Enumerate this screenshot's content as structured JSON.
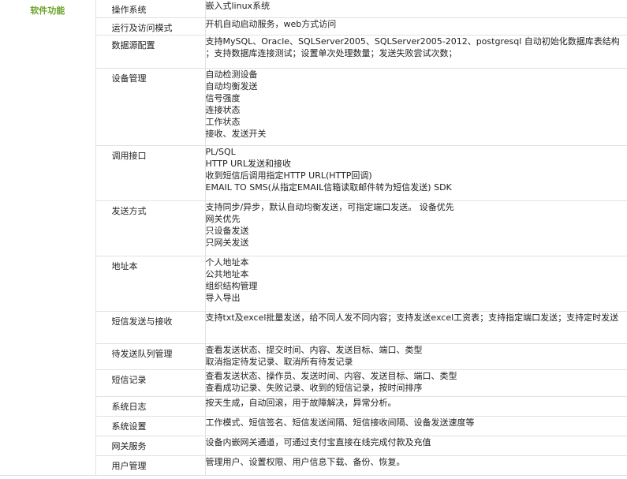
{
  "category": "软件功能",
  "rows": [
    {
      "key": "操作系统",
      "lines": [
        "嵌入式linux系统"
      ]
    },
    {
      "key": "运行及访问模式",
      "lines": [
        "开机自动启动服务，web方式访问"
      ]
    },
    {
      "key": "数据源配置",
      "lines": [
        "支持MySQL、Oracle、SQLServer2005、SQLServer2005-2012、postgresql 自动初始化数据库表结构 ；支持数据库连接测试；设置单次处理数量；发送失败尝试次数；"
      ]
    },
    {
      "key": "设备管理",
      "lines": [
        "自动检测设备",
        "自动均衡发送",
        "信号强度",
        "连接状态",
        "工作状态",
        "接收、发送开关"
      ]
    },
    {
      "key": "调用接口",
      "lines": [
        "PL/SQL",
        "HTTP URL发送和接收",
        "收到短信后调用指定HTTP URL(HTTP回调)",
        "EMAIL TO SMS(从指定EMAIL信箱读取邮件转为短信发送) SDK"
      ]
    },
    {
      "key": "发送方式",
      "lines": [
        "支持同步/异步，默认自动均衡发送，可指定端口发送。 设备优先",
        "网关优先",
        "只设备发送",
        "只网关发送"
      ]
    },
    {
      "key": "地址本",
      "lines": [
        "个人地址本",
        "公共地址本",
        "组织结构管理",
        "导入导出"
      ]
    },
    {
      "key": "短信发送与接收",
      "lines": [
        "支持txt及excel批量发送，给不同人发不同内容；支持发送excel工资表；支持指定端口发送；支持定时发送"
      ]
    },
    {
      "key": "待发送队列管理",
      "lines": [
        "查看发送状态、提交时间、内容、发送目标、端口、类型",
        "取消指定待发记录、取消所有待发记录"
      ]
    },
    {
      "key": "短信记录",
      "lines": [
        "查看发送状态、操作员、发送时间、内容、发送目标、端口、类型",
        "查看成功记录、失败记录、收到的短信记录，按时间排序"
      ]
    },
    {
      "key": "系统日志",
      "lines": [
        "按天生成，自动回滚，用于故障解决，异常分析。"
      ]
    },
    {
      "key": "系统设置",
      "lines": [
        "工作模式、短信签名、短信发送间隔、短信接收间隔、设备发送速度等"
      ]
    },
    {
      "key": "网关服务",
      "lines": [
        "设备内嵌网关通道，可通过支付宝直接在线完成付款及充值"
      ]
    },
    {
      "key": "用户管理",
      "lines": [
        "管理用户、设置权限、用户信息下载、备份、恢复。"
      ]
    }
  ]
}
